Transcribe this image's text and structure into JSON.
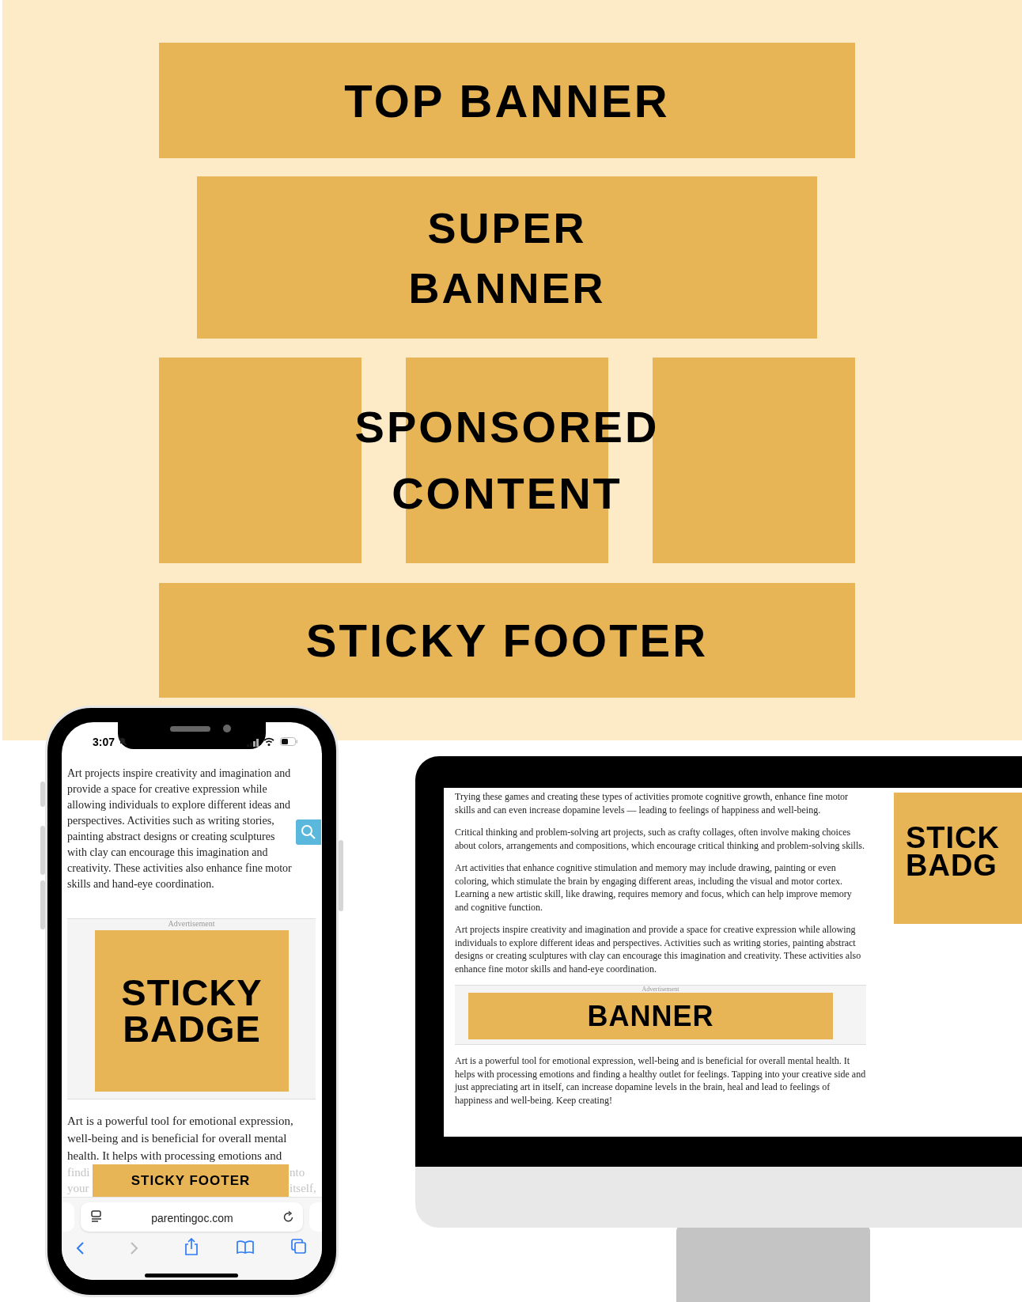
{
  "placement_diagram": {
    "top_banner": "TOP BANNER",
    "super_banner": "SUPER BANNER",
    "sponsored_content": "SPONSORED CONTENT",
    "sticky_footer": "STICKY FOOTER"
  },
  "phone": {
    "status_time": "3:07",
    "paragraph": "Art projects inspire creativity and imagination and provide a space for creative expression while allowing individuals to explore different ideas and perspectives. Activities such as writing stories, painting abstract designs or creating sculptures with clay can encourage this imagination and creativity. These activities also enhance fine motor skills and hand-eye coordination.",
    "ad_label": "Advertisement",
    "badge_ad": "STICKY BADGE",
    "paragraph_after": "Art is a powerful tool for emotional expression, well-being and is beneficial for overall mental health. It helps with processing emotions and",
    "covered_lines": [
      {
        "left": "findi",
        "right": "nto"
      },
      {
        "left": "your",
        "right": "itself,"
      }
    ],
    "sticky_footer": "STICKY FOOTER",
    "url": "parentingoc.com"
  },
  "desktop": {
    "paragraphs": [
      "Trying these games and creating these types of activities promote cognitive growth, enhance fine motor skills and can even increase dopamine levels — leading to feelings of happiness and well-being.",
      "Critical thinking and problem-solving art projects, such as crafty collages, often involve making choices about colors, arrangements and compositions, which encourage critical thinking and problem-solving skills.",
      "Art activities that enhance cognitive stimulation and memory may include drawing, painting or even coloring, which stimulate the brain by engaging different areas, including the visual and motor cortex. Learning a new artistic skill, like drawing, requires memory and focus, which can help improve memory and cognitive function.",
      "Art projects inspire creativity and imagination and provide a space for creative expression while allowing individuals to explore different ideas and perspectives. Activities such as writing stories, painting abstract designs or creating sculptures with clay can encourage this imagination and creativity. These activities also enhance fine motor skills and hand-eye coordination."
    ],
    "ad_label": "Advertisement",
    "banner_ad": "BANNER",
    "paragraph_after": "Art is a powerful tool for emotional expression, well-being and is beneficial for overall mental health. It helps with processing emotions and finding a healthy outlet for feelings. Tapping into your creative side and just appreciating art in itself, can increase dopamine levels in the brain, heal and lead to feelings of happiness and well-being. Keep creating!",
    "sticky_badge_lines": [
      "STICK",
      "BADG"
    ]
  }
}
